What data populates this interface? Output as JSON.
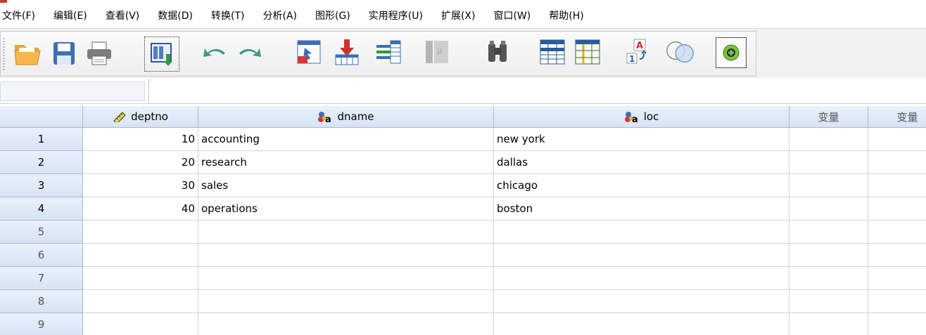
{
  "window": {
    "title_partial": "",
    "app_icon": "spss-icon"
  },
  "menu": [
    "文件(F)",
    "编辑(E)",
    "查看(V)",
    "数据(D)",
    "转换(T)",
    "分析(A)",
    "图形(G)",
    "实用程序(U)",
    "扩展(X)",
    "窗口(W)",
    "帮助(H)"
  ],
  "toolbar": [
    "open-folder-icon",
    "save-icon",
    "print-icon",
    "dialog-recall-icon",
    "undo-icon",
    "redo-icon",
    "goto-case-icon",
    "goto-variable-icon",
    "variables-icon",
    "find-icon-disabled",
    "binoculars-icon",
    "insert-cases-icon",
    "insert-variable-icon",
    "value-labels-icon",
    "use-sets-icon",
    "spell-check-icon"
  ],
  "cell_editor": {
    "reference": "",
    "value": ""
  },
  "grid": {
    "columns": [
      {
        "label": "deptno",
        "icon": "scale-ruler-icon",
        "type": "numeric"
      },
      {
        "label": "dname",
        "icon": "nominal-string-icon",
        "type": "string"
      },
      {
        "label": "loc",
        "icon": "nominal-string-icon",
        "type": "string"
      },
      {
        "label": "变量",
        "icon": "",
        "type": "empty"
      },
      {
        "label": "变量",
        "icon": "",
        "type": "empty"
      }
    ],
    "row_numbers": [
      "1",
      "2",
      "3",
      "4",
      "5",
      "6",
      "7",
      "8",
      "9"
    ],
    "rows": [
      [
        "10",
        "accounting",
        "new york",
        "",
        ""
      ],
      [
        "20",
        "research",
        "dallas",
        "",
        ""
      ],
      [
        "30",
        "sales",
        "chicago",
        "",
        ""
      ],
      [
        "40",
        "operations",
        "boston",
        "",
        ""
      ],
      [
        "",
        "",
        "",
        "",
        ""
      ],
      [
        "",
        "",
        "",
        "",
        ""
      ],
      [
        "",
        "",
        "",
        "",
        ""
      ],
      [
        "",
        "",
        "",
        "",
        ""
      ],
      [
        "",
        "",
        "",
        "",
        ""
      ]
    ],
    "filled_row_count": 4
  },
  "colors": {
    "header_bg": "#dde8f6",
    "grid_line": "#d4d4d4",
    "toolbar_bg": "#f0f0f0"
  }
}
